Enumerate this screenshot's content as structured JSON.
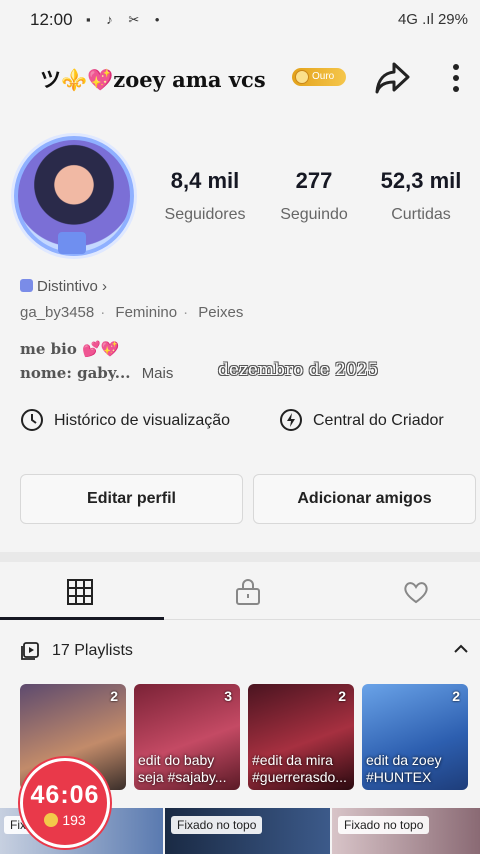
{
  "status_bar": {
    "time": "12:00",
    "right_text": "4G .ıl 29%",
    "left_icons": [
      "image-icon",
      "tiktok-icon",
      "cast-icon",
      "dot"
    ]
  },
  "profile": {
    "username": "ツ⚜️💖zoey ama vcs",
    "badge": "Ouro",
    "stats": [
      {
        "value": "8,4 mil",
        "label": "Seguidores"
      },
      {
        "value": "277",
        "label": "Seguindo"
      },
      {
        "value": "52,3 mil",
        "label": "Curtidas"
      }
    ],
    "distintivo": "Distintivo ›",
    "meta": [
      "ga_by3458",
      "Feminino",
      "Peixes"
    ],
    "bio_line1": "me bio",
    "bio_hearts": "💕💖",
    "bio_line2": "nome: gaby...",
    "bio_more": "Mais",
    "overlay_text": "dezembro de 2025"
  },
  "links": {
    "history": "Histórico de visualização",
    "creator": "Central do Criador"
  },
  "buttons": {
    "edit": "Editar perfil",
    "add_friends": "Adicionar amigos"
  },
  "tabs": [
    "grid-icon",
    "lock-icon",
    "heart-icon"
  ],
  "playlists": {
    "label": "17 Playlists",
    "items": [
      {
        "count": "2",
        "caption": "",
        "color": "#8a6a5a"
      },
      {
        "count": "3",
        "caption": "edit do baby seja #sajaby...",
        "color": "#b0354c"
      },
      {
        "count": "2",
        "caption": "#edit da mira #guerrerasdo...",
        "color": "#7a1f2a"
      },
      {
        "count": "2",
        "caption": "edit da zoey #HUNTEX",
        "color": "#3a6fc0"
      }
    ]
  },
  "timer": {
    "time": "46:06",
    "coins": "193"
  },
  "pinned": {
    "label_short": "Fixa",
    "label": "Fixado no topo"
  },
  "colors": {
    "accent_red": "#e9394a",
    "badge_gold": "#e3a21a"
  }
}
